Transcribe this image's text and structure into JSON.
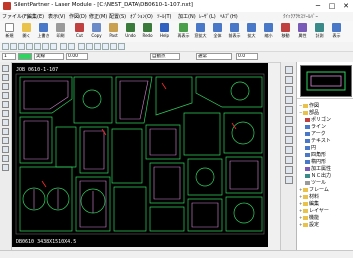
{
  "window": {
    "title": "SilentPartner - Laser Module - [C:\\NEST_DATA\\DB0610-1-107.nxt]",
    "minimize": "─",
    "maximize": "□",
    "close": "✕"
  },
  "menus": [
    "ファイル(F)",
    "編集(E)",
    "表示(V)",
    "作図(D)",
    "修正(M)",
    "配置(S)",
    "ｵﾌﾟｼｮﾝ(O)",
    "ﾂｰﾙ(T)",
    "加工(N)",
    "ﾚｰｻﾞ(L)",
    "ﾍﾙﾌﾟ(H)"
  ],
  "menu_right": "ｸｲｯｸｱｸｾｽﾂｰﾙﾊﾞｰ",
  "toolbar": [
    {
      "label": "新規",
      "icon": "new-file-icon",
      "color": "#ffffff"
    },
    {
      "label": "開く",
      "icon": "open-folder-icon",
      "color": "#e8c24a"
    },
    {
      "label": "上書き",
      "icon": "save-icon",
      "color": "#4a78c8"
    },
    {
      "label": "印刷",
      "icon": "print-icon",
      "color": "#9a9a9a"
    },
    {
      "label": "Cut",
      "icon": "cut-icon",
      "color": "#c04040"
    },
    {
      "label": "Copy",
      "icon": "copy-icon",
      "color": "#6a8ac8"
    },
    {
      "label": "Past",
      "icon": "paste-icon",
      "color": "#c8a050"
    },
    {
      "label": "Undo",
      "icon": "undo-icon",
      "color": "#3a7a3a"
    },
    {
      "label": "Redo",
      "icon": "redo-icon",
      "color": "#3a7a3a"
    },
    {
      "label": "Help",
      "icon": "help-icon",
      "color": "#3060c0"
    },
    {
      "label": "再表示",
      "icon": "redraw-icon",
      "color": "#4aa04a"
    },
    {
      "label": "窓拡大",
      "icon": "zoom-window-icon",
      "color": "#4a78c8"
    },
    {
      "label": "全体",
      "icon": "fit-all-icon",
      "color": "#4a78c8"
    },
    {
      "label": "前表示",
      "icon": "prev-view-icon",
      "color": "#4a78c8"
    },
    {
      "label": "拡大",
      "icon": "zoom-in-icon",
      "color": "#4a78c8"
    },
    {
      "label": "縮小",
      "icon": "zoom-out-icon",
      "color": "#4a78c8"
    },
    {
      "label": "移動",
      "icon": "pan-icon",
      "color": "#c04040"
    },
    {
      "label": "属性",
      "icon": "attribute-icon",
      "color": "#7a5ab8"
    },
    {
      "label": "計測",
      "icon": "measure-icon",
      "color": "#3a8a8a"
    },
    {
      "label": "表示",
      "icon": "display-icon",
      "color": "#4a78c8"
    }
  ],
  "toolbar2_labels": [
    "単一点",
    "端点",
    "中点",
    "交点",
    "中心",
    "垂直",
    "接点",
    "直交",
    "平行",
    "長方形",
    "中弧",
    "円",
    "楕円",
    "文字",
    "寸法"
  ],
  "toolbar3": {
    "layer": "1",
    "color_label": "色",
    "line_type": "実線",
    "width": "0.00",
    "mode": "自動点",
    "attr": "通常",
    "value": "0.0"
  },
  "drawing": {
    "sheet_label": "JOB 0610-1-107",
    "bottom_label": "DB0610 3438X1510X4.5",
    "palette": {
      "part": "#2fd35f",
      "cutline": "#d98ad9",
      "red": "#ff2a2a",
      "grid": "#666666"
    }
  },
  "tree": [
    {
      "label": "作図",
      "indent": 0
    },
    {
      "label": "部品",
      "indent": 0
    },
    {
      "label": "ポリゴン",
      "indent": 1
    },
    {
      "label": "ライン",
      "indent": 1
    },
    {
      "label": "アーク",
      "indent": 1
    },
    {
      "label": "テキスト",
      "indent": 1
    },
    {
      "label": "円",
      "indent": 1
    },
    {
      "label": "四角形",
      "indent": 1
    },
    {
      "label": "楕円形",
      "indent": 1
    },
    {
      "label": "加工属性",
      "indent": 1
    },
    {
      "label": "ＮＣ出力",
      "indent": 1
    },
    {
      "label": "ツール",
      "indent": 1
    },
    {
      "label": "フレーム",
      "indent": 0
    },
    {
      "label": "材料",
      "indent": 0
    },
    {
      "label": "編集",
      "indent": 0
    },
    {
      "label": "レイヤー",
      "indent": 0
    },
    {
      "label": "機能",
      "indent": 0
    },
    {
      "label": "設定",
      "indent": 0
    }
  ],
  "status": {
    "left": "",
    "right": ""
  }
}
